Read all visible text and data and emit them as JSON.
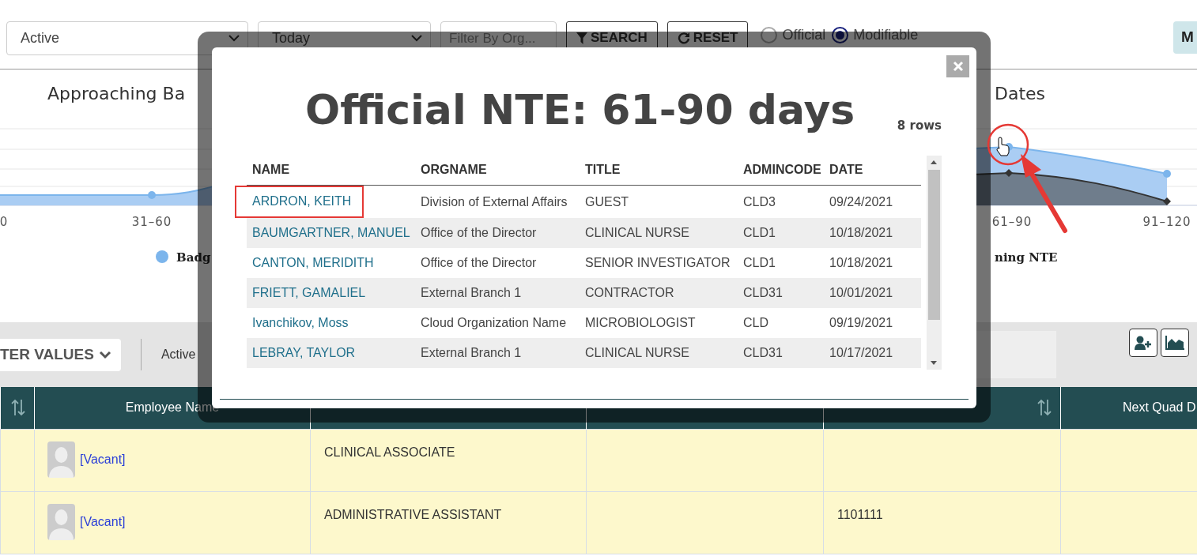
{
  "filters": {
    "status": {
      "value": "Active"
    },
    "period": {
      "value": "Today"
    },
    "org": {
      "placeholder": "Filter By Org..."
    },
    "buttons": [
      {
        "label": "SEARCH",
        "kind": "search"
      },
      {
        "label": "RESET",
        "kind": "reset"
      }
    ],
    "modes": [
      {
        "label": "Official",
        "selected": false
      },
      {
        "label": "Modifiable",
        "selected": true
      }
    ],
    "side_button": "M"
  },
  "chart": {
    "title_left": "Approaching Ba",
    "title_right": "Dates",
    "x_labels": [
      "0",
      "31–60",
      "61–90",
      "91–120"
    ],
    "legend": [
      {
        "label": "Badg",
        "color": "#7cb5ec"
      },
      {
        "label": "ning NTE"
      }
    ]
  },
  "toolbar": {
    "filter_button": "TER VALUES",
    "saved_label": "Active"
  },
  "grid": {
    "columns": [
      {
        "kind": "sort"
      },
      {
        "kind": "label",
        "label": "Employee Name"
      },
      {
        "kind": "blank"
      },
      {
        "kind": "blank"
      },
      {
        "kind": "sort"
      },
      {
        "kind": "label",
        "label": "Next Quad D"
      }
    ],
    "rows": [
      {
        "employee": "[Vacant]",
        "position": "CLINICAL ASSOCIATE"
      },
      {
        "employee": "[Vacant]",
        "position": "ADMINISTRATIVE ASSISTANT",
        "can": "1101111"
      }
    ]
  },
  "modal": {
    "title": "Official NTE: 61-90 days",
    "row_count": "8 rows",
    "columns": [
      "NAME",
      "ORGNAME",
      "TITLE",
      "ADMINCODE",
      "DATE"
    ],
    "rows": [
      {
        "cells": [
          "ARDRON, KEITH",
          "Division of External Affairs",
          "GUEST",
          "CLD3",
          "09/24/2021"
        ],
        "highlighted": true
      },
      {
        "cells": [
          "BAUMGARTNER, MANUEL",
          "Office of the Director",
          "CLINICAL NURSE",
          "CLD1",
          "10/18/2021"
        ],
        "highlighted": false
      },
      {
        "cells": [
          "CANTON, MERIDITH",
          "Office of the Director",
          "SENIOR INVESTIGATOR",
          "CLD1",
          "10/18/2021"
        ],
        "highlighted": false
      },
      {
        "cells": [
          "FRIETT, GAMALIEL",
          "External Branch 1",
          "CONTRACTOR",
          "CLD31",
          "10/01/2021"
        ],
        "highlighted": false
      },
      {
        "cells": [
          "Ivanchikov, Moss",
          "Cloud Organization Name",
          "MICROBIOLOGIST",
          "CLD",
          "09/19/2021"
        ],
        "highlighted": false
      },
      {
        "cells": [
          "LEBRAY, TAYLOR",
          "External Branch 1",
          "CLINICAL NURSE",
          "CLD31",
          "10/17/2021"
        ],
        "highlighted": false
      }
    ]
  }
}
